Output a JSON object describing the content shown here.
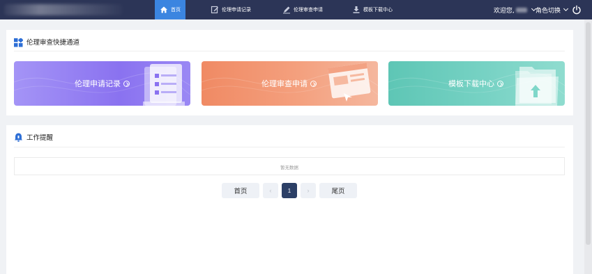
{
  "nav": {
    "home": "首页",
    "record": "伦理申请记录",
    "apply": "伦理审查申请",
    "download": "模板下载中心"
  },
  "user": {
    "welcome": "欢迎您,",
    "role_switch": "角色切换"
  },
  "quick_access": {
    "title": "伦理审查快捷通道",
    "cards": [
      {
        "label": "伦理申请记录"
      },
      {
        "label": "伦理审查申请"
      },
      {
        "label": "模板下载中心"
      }
    ]
  },
  "reminders": {
    "title": "工作提醒",
    "empty_text": "暂无数据"
  },
  "pagination": {
    "first": "首页",
    "prev": "‹",
    "current": "1",
    "next": "›",
    "last": "尾页"
  },
  "colors": {
    "topbar": "#2c3557",
    "active_nav": "#3b85e0",
    "card_purple": "#8a72f0",
    "card_orange": "#f08a64",
    "card_teal": "#5ec6b5",
    "page_active": "#2c3f66"
  }
}
